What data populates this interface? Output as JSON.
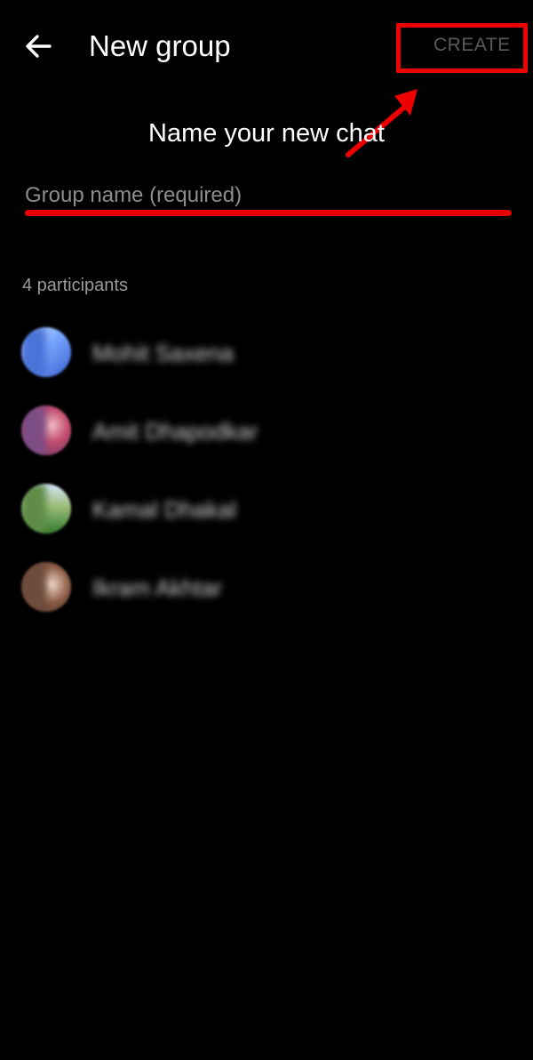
{
  "header": {
    "title": "New group",
    "create_label": "CREATE"
  },
  "heading": "Name your new chat",
  "group_name": {
    "value": "",
    "placeholder": "Group name (required)"
  },
  "participants": {
    "count_label": "4 participants",
    "items": [
      {
        "name": "Mohit Saxena"
      },
      {
        "name": "Amit Dhapodkar"
      },
      {
        "name": "Kamal Dhakal"
      },
      {
        "name": "Ikram Akhtar"
      }
    ]
  },
  "colors": {
    "background": "#000000",
    "annotation": "#e00000",
    "create_disabled": "#5a5a5a"
  }
}
